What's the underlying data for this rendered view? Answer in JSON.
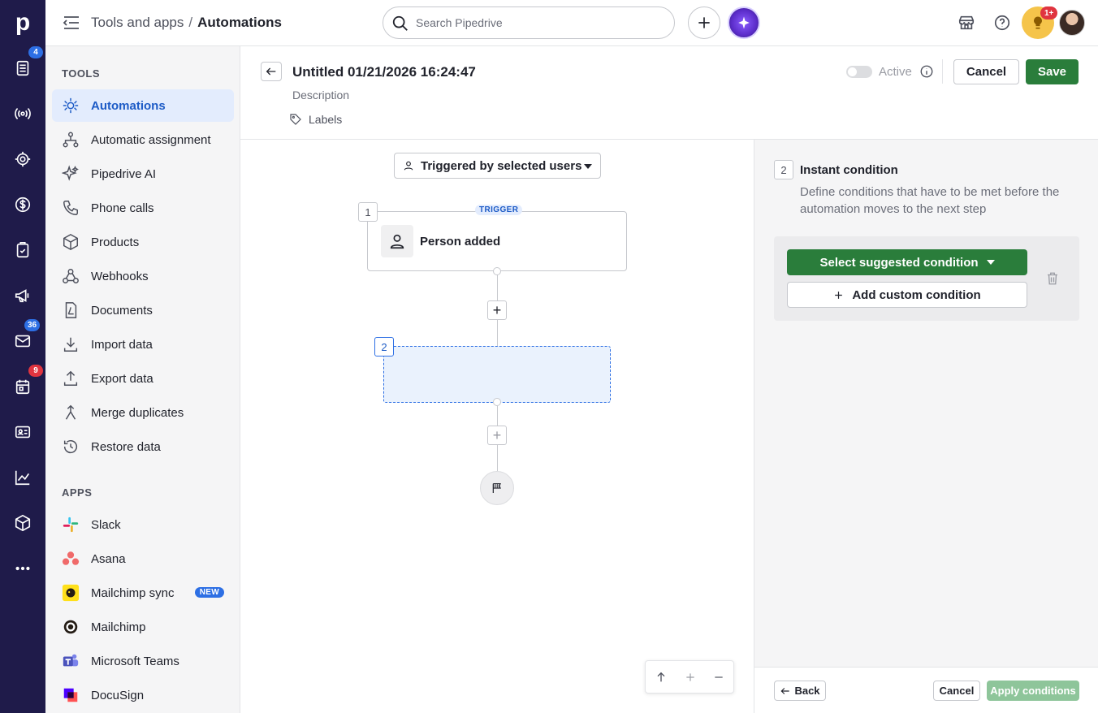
{
  "app": {
    "logo": "p"
  },
  "rail": {
    "items": [
      {
        "icon": "leads-icon",
        "badge": "4"
      },
      {
        "icon": "broadcast-icon",
        "badge": ""
      },
      {
        "icon": "target-icon",
        "badge": ""
      },
      {
        "icon": "dollar-icon",
        "badge": ""
      },
      {
        "icon": "tasks-icon",
        "badge": ""
      },
      {
        "icon": "megaphone-icon",
        "badge": ""
      },
      {
        "icon": "mail-icon",
        "badge": "36"
      },
      {
        "icon": "calendar-icon",
        "badge": "9"
      },
      {
        "icon": "contacts-icon",
        "badge": ""
      },
      {
        "icon": "chart-icon",
        "badge": ""
      },
      {
        "icon": "box-icon",
        "badge": ""
      },
      {
        "icon": "more-icon",
        "badge": ""
      }
    ]
  },
  "topbar": {
    "breadcrumb_parent": "Tools and apps",
    "breadcrumb_sep": "/",
    "breadcrumb_current": "Automations",
    "search_placeholder": "Search Pipedrive",
    "notification_badge": "1+"
  },
  "sidebar": {
    "tools_title": "TOOLS",
    "tools": [
      {
        "label": "Automations",
        "icon": "automations-icon",
        "active": true
      },
      {
        "label": "Automatic assignment",
        "icon": "assignment-icon"
      },
      {
        "label": "Pipedrive AI",
        "icon": "sparkle-icon"
      },
      {
        "label": "Phone calls",
        "icon": "phone-icon"
      },
      {
        "label": "Products",
        "icon": "box-icon"
      },
      {
        "label": "Webhooks",
        "icon": "webhook-icon"
      },
      {
        "label": "Documents",
        "icon": "document-icon"
      },
      {
        "label": "Import data",
        "icon": "import-icon"
      },
      {
        "label": "Export data",
        "icon": "export-icon"
      },
      {
        "label": "Merge duplicates",
        "icon": "merge-icon"
      },
      {
        "label": "Restore data",
        "icon": "restore-icon"
      }
    ],
    "apps_title": "APPS",
    "apps": [
      {
        "label": "Slack",
        "icon": "slack-icon"
      },
      {
        "label": "Asana",
        "icon": "asana-icon"
      },
      {
        "label": "Mailchimp sync",
        "icon": "mailchimp-icon",
        "badge": "NEW"
      },
      {
        "label": "Mailchimp",
        "icon": "mailchimp-icon"
      },
      {
        "label": "Microsoft Teams",
        "icon": "teams-icon"
      },
      {
        "label": "DocuSign",
        "icon": "docusign-icon"
      }
    ]
  },
  "editor": {
    "title": "Untitled 01/21/2026 16:24:47",
    "description_placeholder": "Description",
    "labels": "Labels",
    "active_label": "Active",
    "cancel": "Cancel",
    "save": "Save"
  },
  "canvas": {
    "trigger_select": "Triggered by selected users",
    "step1_num": "1",
    "trigger_tag": "TRIGGER",
    "step1_label": "Person added",
    "step2_num": "2"
  },
  "panel": {
    "step_num": "2",
    "title": "Instant condition",
    "description": "Define conditions that have to be met before the automation moves to the next step",
    "suggest_button": "Select suggested condition",
    "custom_button": "Add custom condition",
    "back": "Back",
    "cancel": "Cancel",
    "apply": "Apply conditions"
  },
  "colors": {
    "rail_bg": "#1f1b4a",
    "accent_blue": "#2d6fe4",
    "save_green": "#2a7d3b",
    "apply_disabled": "#8ec59a"
  }
}
